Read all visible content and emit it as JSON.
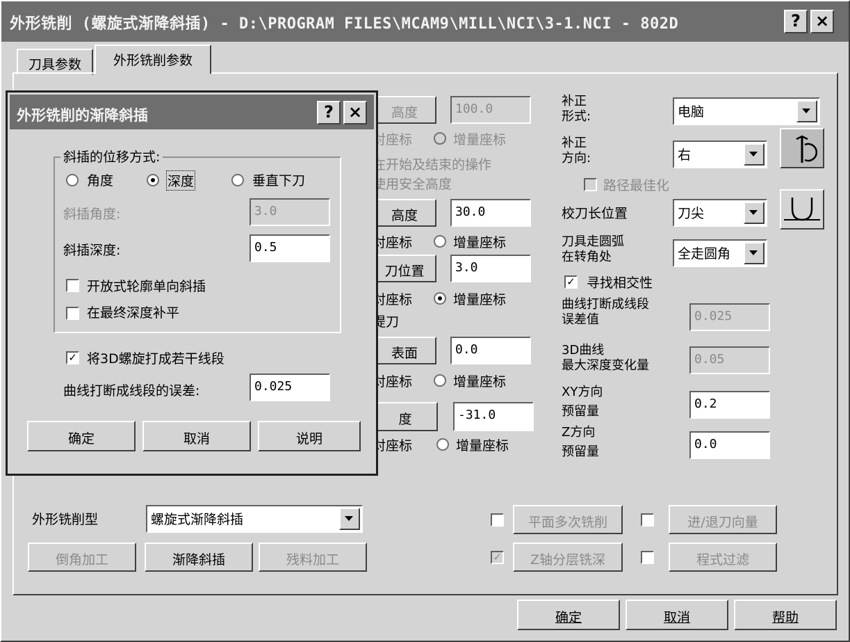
{
  "window": {
    "title": "外形铣削 (螺旋式渐降斜插) - D:\\PROGRAM FILES\\MCAM9\\MILL\\NCI\\3-1.NCI - 802D",
    "help_btn": "?",
    "close_btn": "×"
  },
  "tabs": [
    {
      "label": "刀具参数"
    },
    {
      "label": "外形铣削参数"
    }
  ],
  "left": {
    "height1_btn": "高度",
    "height1_val": "100.0",
    "abs1": "对座标",
    "inc1": "增量座标",
    "safe_note1": "在开始及结束的操作",
    "safe_note2": "使用安全高度",
    "height2_btn": "高度",
    "height2_val": "30.0",
    "abs2": "对座标",
    "inc2": "增量座标",
    "feed_btn": "刀位置",
    "feed_val": "3.0",
    "abs3": "对座标",
    "inc3": "增量座标",
    "rapid": "提刀",
    "top_btn": "表面",
    "top_val": "0.0",
    "abs4": "对座标",
    "inc4": "增量座标",
    "depth_btn": "度",
    "depth_val": "-31.0",
    "abs5": "对座标",
    "inc5": "增量座标"
  },
  "right": {
    "comp_type_label1": "补正",
    "comp_type_label2": "形式:",
    "comp_type_val": "电脑",
    "comp_dir_label1": "补正",
    "comp_dir_label2": "方向:",
    "comp_dir_val": "右",
    "roll_opt": "路径最佳化",
    "tip_label": "校刀长位置",
    "tip_val": "刀尖",
    "arc_label1": "刀具走圆弧",
    "arc_label2": "在转角处",
    "arc_val": "全走圆角",
    "find_intersect": "寻找相交性",
    "tol_label1": "曲线打断成线段",
    "tol_label2": "误差值",
    "tol_val": "0.025",
    "depth3d_label1": "3D曲线",
    "depth3d_label2": "最大深度变化量",
    "depth3d_val": "0.05",
    "xy_label1": "XY方向",
    "xy_label2": "预留量",
    "xy_val": "0.2",
    "z_label1": "Z方向",
    "z_label2": "预留量",
    "z_val": "0.0"
  },
  "bottom": {
    "type_label": "外形铣削型",
    "type_val": "螺旋式渐降斜插",
    "chamfer": "倒角加工",
    "ramp": "渐降斜插",
    "remach": "残料加工",
    "multipass": "平面多次铣削",
    "leadinout": "进/退刀向量",
    "depthcuts": "Z轴分层铣深",
    "filter": "程式过滤",
    "ok": "确定",
    "cancel": "取消",
    "help": "帮助"
  },
  "dialog": {
    "title": "外形铣削的渐降斜插",
    "help_btn": "?",
    "close_btn": "×",
    "group_label": "斜插的位移方式:",
    "opt_angle": "角度",
    "opt_depth": "深度",
    "opt_plunge": "垂直下刀",
    "ramp_angle_label": "斜插角度:",
    "ramp_angle_val": "3.0",
    "ramp_depth_label": "斜插深度:",
    "ramp_depth_val": "0.5",
    "open_contour": "开放式轮廓单向斜插",
    "final_depth": "在最终深度补平",
    "break3d": "将3D螺旋打成若干线段",
    "break_tol_label": "曲线打断成线段的误差:",
    "break_tol_val": "0.025",
    "ok": "确定",
    "cancel": "取消",
    "help": "说明"
  }
}
